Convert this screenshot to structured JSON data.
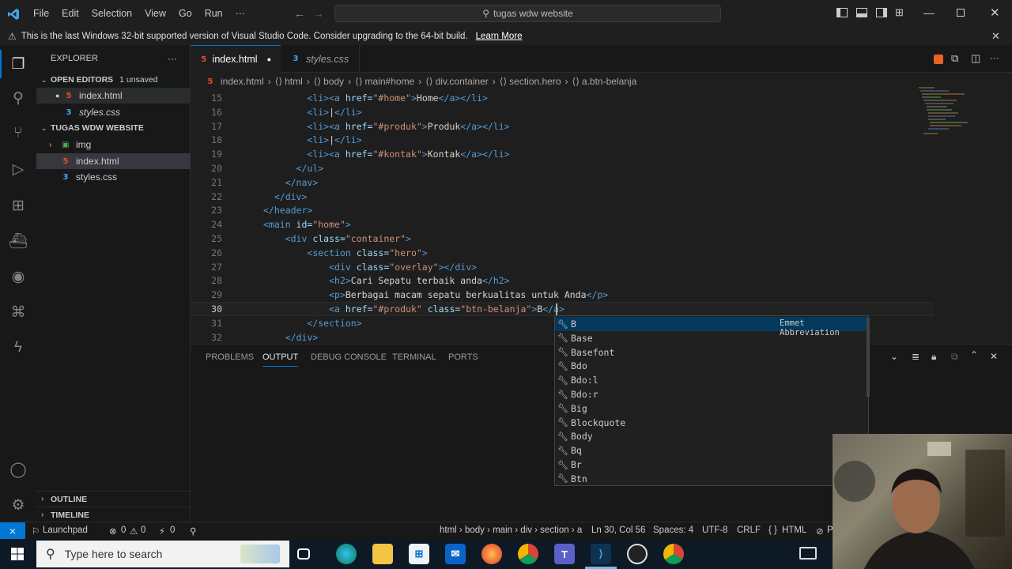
{
  "titlebar": {
    "menus": [
      "File",
      "Edit",
      "Selection",
      "View",
      "Go",
      "Run",
      "···"
    ],
    "search_text": "tugas wdw website"
  },
  "banner": {
    "message": "This is the last Windows 32-bit supported version of Visual Studio Code. Consider upgrading to the 64-bit build.",
    "link": "Learn More"
  },
  "sidebar": {
    "title": "EXPLORER",
    "open_editors_label": "OPEN EDITORS",
    "unsaved_badge": "1 unsaved",
    "open_editors": [
      {
        "name": "index.html",
        "type": "html"
      },
      {
        "name": "styles.css",
        "type": "css"
      }
    ],
    "project_label": "TUGAS WDW WEBSITE",
    "tree": [
      {
        "name": "img",
        "type": "folder"
      },
      {
        "name": "index.html",
        "type": "html"
      },
      {
        "name": "styles.css",
        "type": "css"
      }
    ],
    "outline_label": "OUTLINE",
    "timeline_label": "TIMELINE"
  },
  "tabs": [
    {
      "label": "index.html",
      "active": true,
      "dirty": true
    },
    {
      "label": "styles.css",
      "active": false,
      "dirty": false
    }
  ],
  "breadcrumb": [
    "index.html",
    "html",
    "body",
    "main#home",
    "div.container",
    "section.hero",
    "a.btn-belanja"
  ],
  "editor": {
    "lines": [
      {
        "n": "15",
        "indent": "        ",
        "tokens": [
          [
            "tg",
            "<li><a "
          ],
          [
            "at",
            "href="
          ],
          [
            "st",
            "\"#home\""
          ],
          [
            "tg",
            ">"
          ],
          [
            "tx",
            "Home"
          ],
          [
            "tg",
            "</a></li>"
          ]
        ]
      },
      {
        "n": "16",
        "indent": "        ",
        "tokens": [
          [
            "tg",
            "<li>"
          ],
          [
            "tx",
            "|"
          ],
          [
            "tg",
            "</li>"
          ]
        ]
      },
      {
        "n": "17",
        "indent": "        ",
        "tokens": [
          [
            "tg",
            "<li><a "
          ],
          [
            "at",
            "href="
          ],
          [
            "st",
            "\"#produk\""
          ],
          [
            "tg",
            ">"
          ],
          [
            "tx",
            "Produk"
          ],
          [
            "tg",
            "</a></li>"
          ]
        ]
      },
      {
        "n": "18",
        "indent": "        ",
        "tokens": [
          [
            "tg",
            "<li>"
          ],
          [
            "tx",
            "|"
          ],
          [
            "tg",
            "</li>"
          ]
        ]
      },
      {
        "n": "19",
        "indent": "        ",
        "tokens": [
          [
            "tg",
            "<li><a "
          ],
          [
            "at",
            "href="
          ],
          [
            "st",
            "\"#kontak\""
          ],
          [
            "tg",
            ">"
          ],
          [
            "tx",
            "Kontak"
          ],
          [
            "tg",
            "</a></li>"
          ]
        ]
      },
      {
        "n": "20",
        "indent": "      ",
        "tokens": [
          [
            "tg",
            "</ul>"
          ]
        ]
      },
      {
        "n": "21",
        "indent": "    ",
        "tokens": [
          [
            "tg",
            "</nav>"
          ]
        ]
      },
      {
        "n": "22",
        "indent": "  ",
        "tokens": [
          [
            "tg",
            "</div>"
          ]
        ]
      },
      {
        "n": "23",
        "indent": "",
        "tokens": [
          [
            "tg",
            "</header>"
          ]
        ]
      },
      {
        "n": "24",
        "indent": "",
        "tokens": [
          [
            "tg",
            "<main "
          ],
          [
            "at",
            "id="
          ],
          [
            "st",
            "\"home\""
          ],
          [
            "tg",
            ">"
          ]
        ]
      },
      {
        "n": "25",
        "indent": "    ",
        "tokens": [
          [
            "tg",
            "<div "
          ],
          [
            "at",
            "class="
          ],
          [
            "st",
            "\"container\""
          ],
          [
            "tg",
            ">"
          ]
        ]
      },
      {
        "n": "26",
        "indent": "        ",
        "tokens": [
          [
            "tg",
            "<section "
          ],
          [
            "at",
            "class="
          ],
          [
            "st",
            "\"hero\""
          ],
          [
            "tg",
            ">"
          ]
        ]
      },
      {
        "n": "27",
        "indent": "            ",
        "tokens": [
          [
            "tg",
            "<div "
          ],
          [
            "at",
            "class="
          ],
          [
            "st",
            "\"overlay\""
          ],
          [
            "tg",
            "></div>"
          ]
        ]
      },
      {
        "n": "28",
        "indent": "            ",
        "tokens": [
          [
            "tg",
            "<h2>"
          ],
          [
            "tx",
            "Cari Sepatu terbaik anda"
          ],
          [
            "tg",
            "</h2>"
          ]
        ]
      },
      {
        "n": "29",
        "indent": "            ",
        "tokens": [
          [
            "tg",
            "<p>"
          ],
          [
            "tx",
            "Berbagai macam sepatu berkualitas untuk Anda"
          ],
          [
            "tg",
            "</p>"
          ]
        ]
      },
      {
        "n": "30",
        "indent": "            ",
        "tokens": [
          [
            "tg",
            "<a "
          ],
          [
            "at",
            "href="
          ],
          [
            "st",
            "\"#produk\""
          ],
          [
            "tx",
            " "
          ],
          [
            "at",
            "class="
          ],
          [
            "st",
            "\"btn-belanja\""
          ],
          [
            "tg",
            ">"
          ],
          [
            "tx",
            "B"
          ],
          [
            "tg",
            "</a>"
          ]
        ]
      },
      {
        "n": "31",
        "indent": "        ",
        "tokens": [
          [
            "tg",
            "</section>"
          ]
        ]
      },
      {
        "n": "32",
        "indent": "    ",
        "tokens": [
          [
            "tg",
            "</div>"
          ]
        ]
      }
    ]
  },
  "suggest": {
    "detail": "Emmet Abbreviation",
    "items": [
      "B",
      "Base",
      "Basefont",
      "Bdo",
      "Bdo:l",
      "Bdo:r",
      "Big",
      "Blockquote",
      "Body",
      "Bq",
      "Br",
      "Btn"
    ]
  },
  "panel": {
    "tabs": [
      "PROBLEMS",
      "OUTPUT",
      "DEBUG CONSOLE",
      "TERMINAL",
      "PORTS"
    ],
    "active_tab": "OUTPUT"
  },
  "statusbar": {
    "remote": "⨯",
    "launchpad": "Launchpad",
    "errors": "0",
    "warnings": "0",
    "ports": "0",
    "path": "html › body › main › div › section › a",
    "position": "Ln 30, Col 56",
    "spaces": "Spaces: 4",
    "encoding": "UTF-8",
    "eol": "CRLF",
    "language": "HTML",
    "prettier": "P"
  },
  "taskbar": {
    "search_placeholder": "Type here to search"
  },
  "colors": {
    "accent": "#0078d4",
    "html_icon": "#e44d26",
    "css_icon": "#42a5f5"
  }
}
